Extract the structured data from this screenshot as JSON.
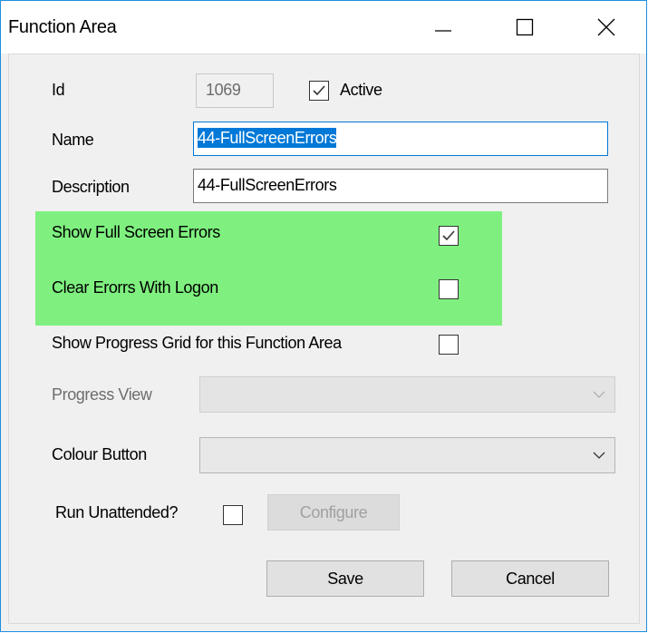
{
  "window": {
    "title": "Function Area"
  },
  "form": {
    "id_label": "Id",
    "id_value": "1069",
    "active_label": "Active",
    "active_checked": true,
    "name_label": "Name",
    "name_value": "44-FullScreenErrors",
    "description_label": "Description",
    "description_value": "44-FullScreenErrors",
    "show_full_screen_errors_label": "Show Full Screen Errors",
    "show_full_screen_errors_checked": true,
    "clear_errors_label": "Clear Erorrs With Logon",
    "clear_errors_checked": false,
    "show_progress_grid_label": "Show Progress Grid for this Function Area",
    "show_progress_grid_checked": false,
    "progress_view_label": "Progress View",
    "progress_view_value": "",
    "colour_button_label": "Colour Button",
    "colour_button_value": "",
    "run_unattended_label": "Run Unattended?",
    "run_unattended_checked": false,
    "configure_label": "Configure"
  },
  "buttons": {
    "save": "Save",
    "cancel": "Cancel"
  },
  "colors": {
    "highlight": "#7ff07f",
    "accent": "#0078d7",
    "window_border": "#1d8fe0"
  }
}
